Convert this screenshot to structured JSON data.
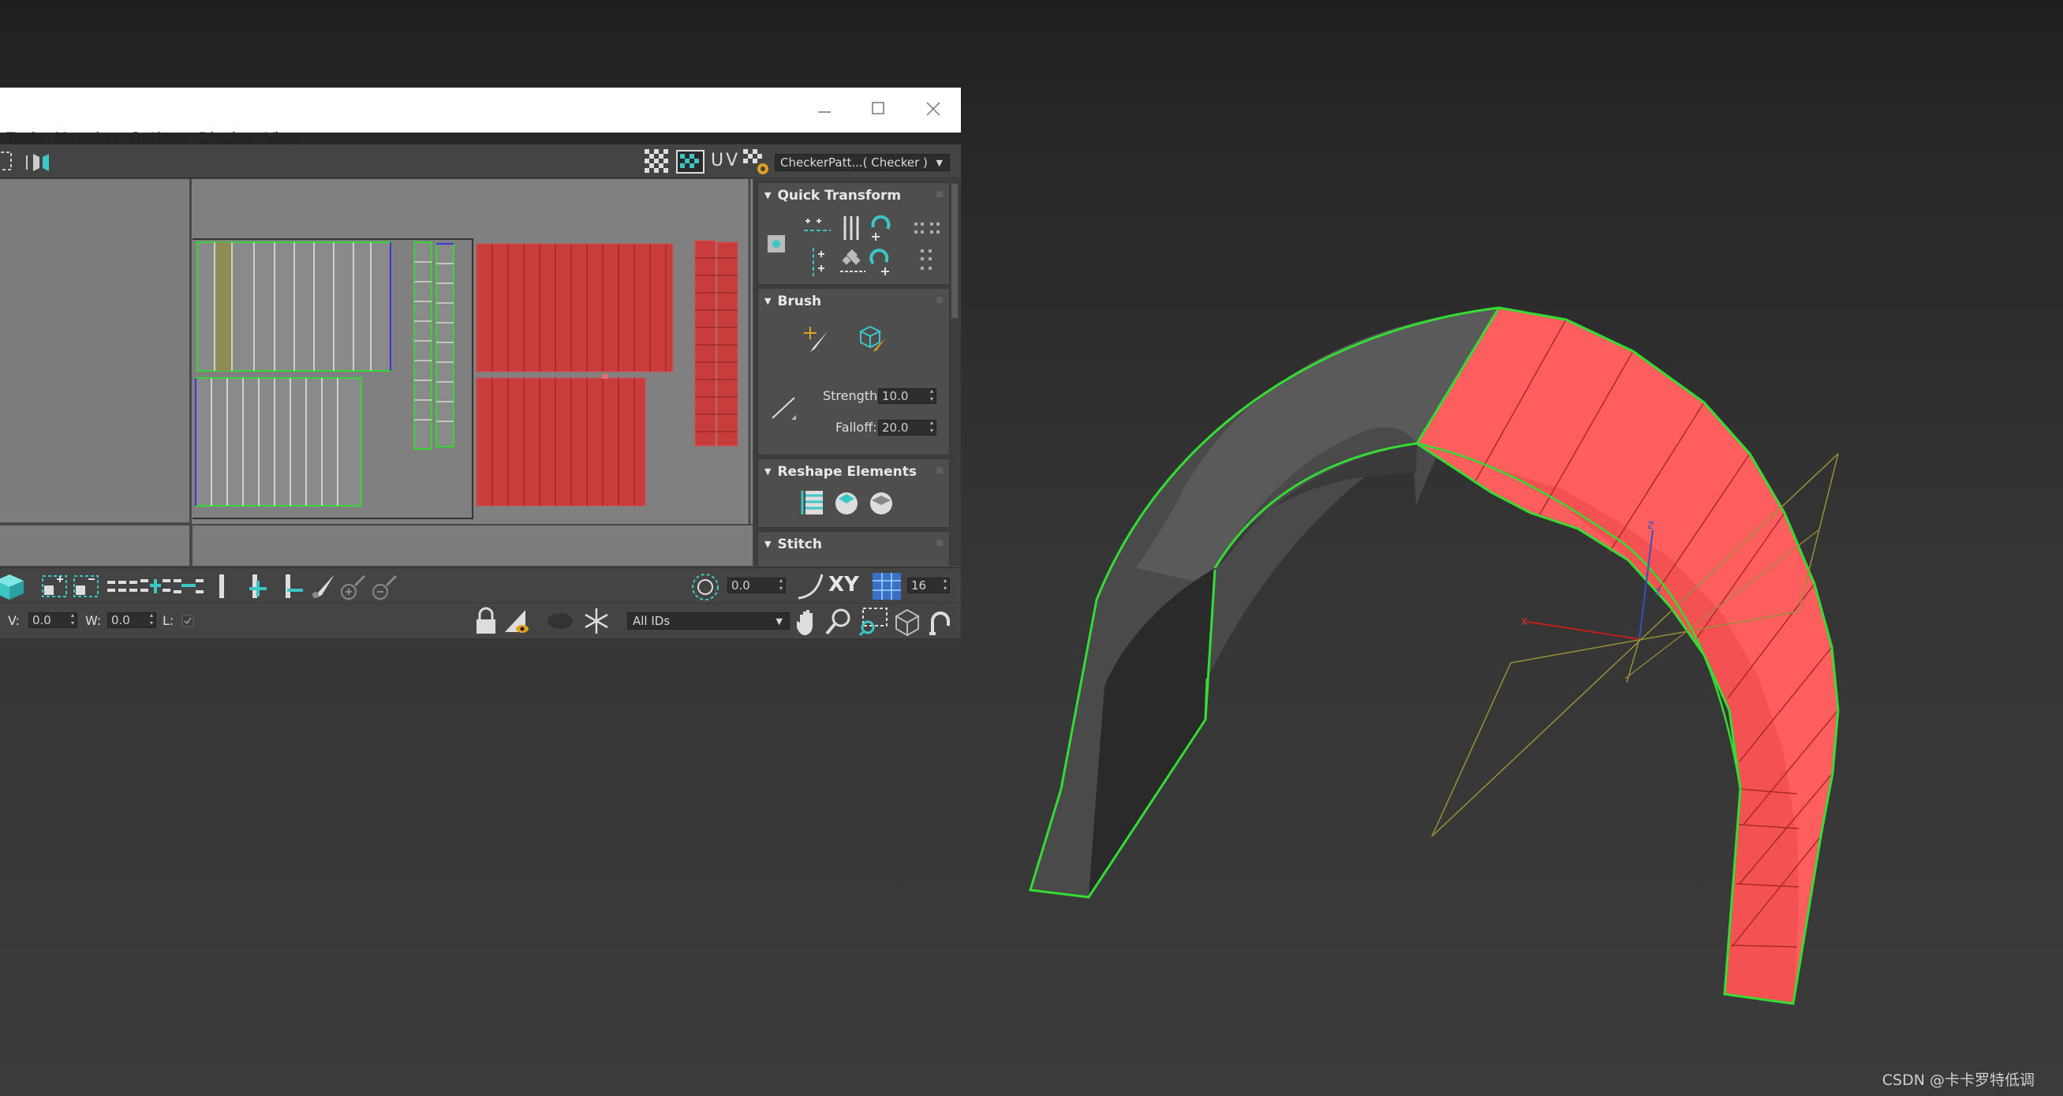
{
  "window": {
    "menu": [
      "Tools",
      "Mapping",
      "Options",
      "Display",
      "View"
    ],
    "controls": {
      "minimize": "minimize-icon",
      "maximize": "maximize-icon",
      "close": "close-icon"
    }
  },
  "toolbar_top": {
    "uv_label": "UV",
    "checker_pattern": "CheckerPatt...( Checker )"
  },
  "panels": {
    "quick_transform": {
      "title": "Quick Transform"
    },
    "brush": {
      "title": "Brush",
      "strength_label": "Strength:",
      "strength_value": "10.0",
      "falloff_label": "Falloff:",
      "falloff_value": "20.0"
    },
    "reshape": {
      "title": "Reshape Elements"
    },
    "stitch": {
      "title": "Stitch"
    }
  },
  "toolbar_bottom": {
    "rotate_value": "0.0",
    "axis_label": "XY",
    "grid_value": "16"
  },
  "statusbar": {
    "v_label": "V:",
    "v_value": "0.0",
    "w_label": "W:",
    "w_value": "0.0",
    "l_label": "L:",
    "ids_value": "All IDs"
  },
  "viewport": {
    "axis_z1": "z",
    "axis_z2": "z",
    "axis_x": "x"
  },
  "watermark": "CSDN @卡卡罗特低调",
  "colors": {
    "selected_face": "#ff5a5a",
    "edge_highlight": "#33dd33",
    "uv_bg": "#7c7c7c",
    "panel_bg": "#444444"
  }
}
